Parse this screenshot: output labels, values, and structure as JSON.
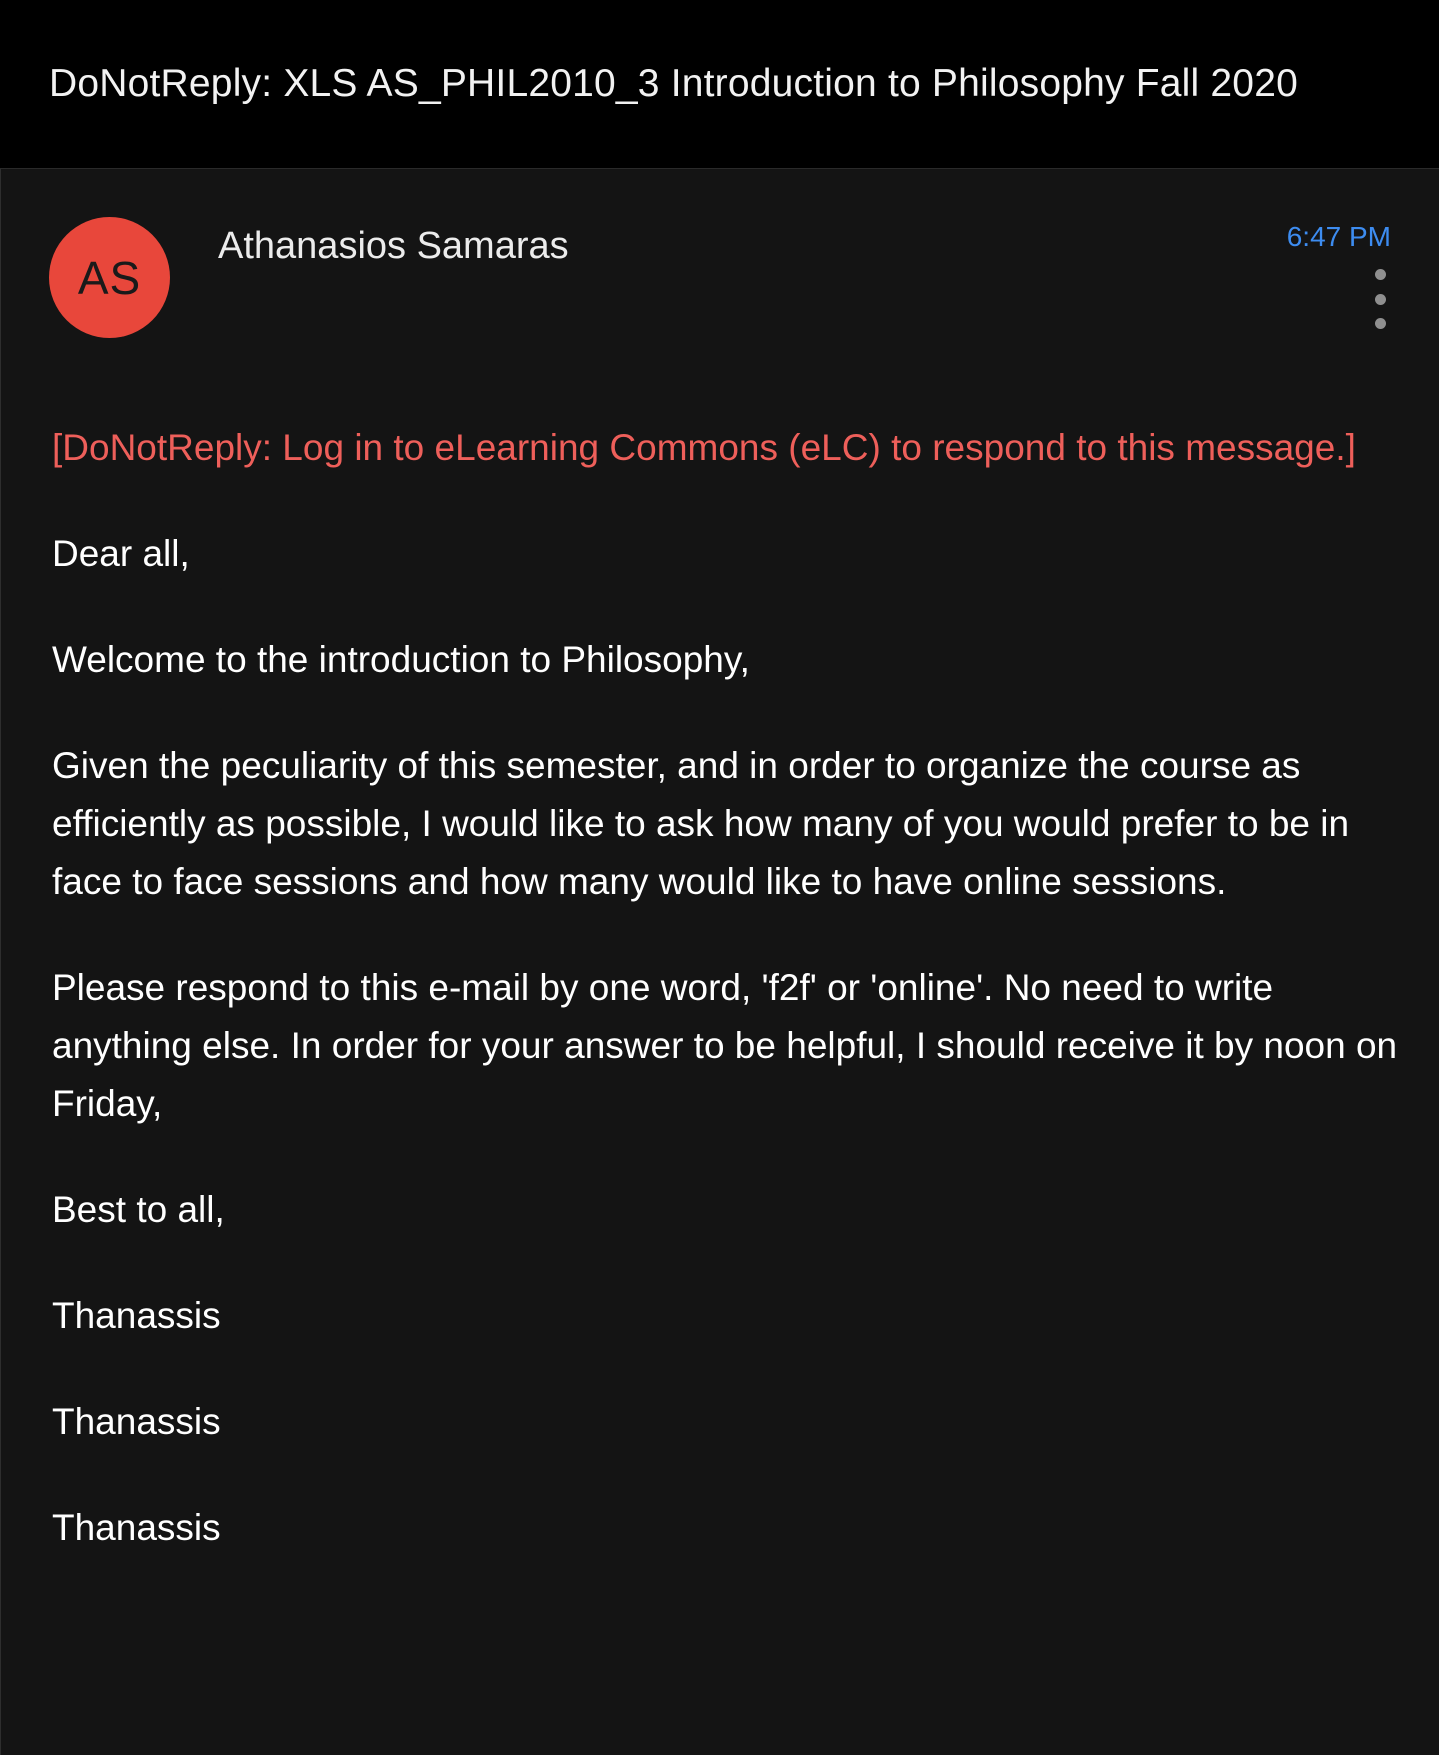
{
  "header": {
    "subject": "DoNotReply:  XLS AS_PHIL2010_3 Introduction to Philosophy Fall 2020"
  },
  "message": {
    "avatar_initials": "AS",
    "avatar_color": "#e8473b",
    "sender_name": "Athanasios Samaras",
    "time": "6:47 PM",
    "time_color": "#3d8cf0",
    "more_options_icon": "vertical-ellipsis-icon"
  },
  "body": {
    "notice": "[DoNotReply: Log in to eLearning Commons (eLC) to respond to this message.]",
    "notice_color": "#ee5f5a",
    "paragraphs": [
      "Dear all,",
      "Welcome to the introduction to Philosophy,",
      "Given the peculiarity of this semester, and in order to organize the course as efficiently as possible, I would like to ask how many of you would prefer to be in face to face sessions and how many would like to have online sessions.",
      "Please respond to this e-mail by one word, 'f2f' or 'online'. No need to write anything else. In order for your answer to be helpful, I should receive it by noon on Friday,",
      "Best to all,",
      "Thanassis",
      "Thanassis",
      "Thanassis"
    ]
  }
}
